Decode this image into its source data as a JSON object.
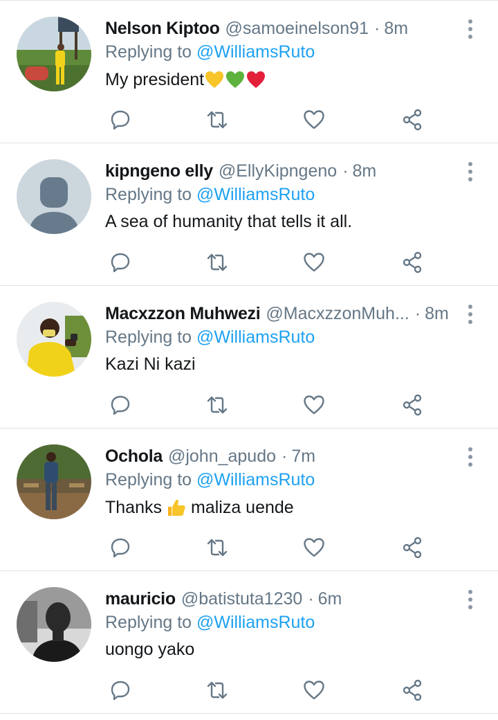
{
  "colors": {
    "link": "#1da1f2",
    "muted": "#657786",
    "text": "#14171a",
    "divider": "#dfe3e8"
  },
  "icons": {
    "reply": "reply-icon",
    "retweet": "retweet-icon",
    "like": "like-icon",
    "share": "share-icon",
    "more": "more-options-icon"
  },
  "tweets": [
    {
      "name": "Nelson Kiptoo",
      "handle": "@samoeinelson91",
      "separator": "·",
      "time": "8m",
      "replying_prefix": "Replying to",
      "replying_to": "@WilliamsRuto",
      "text": "My president",
      "emojis": [
        "yellow-heart",
        "green-heart",
        "red-heart"
      ]
    },
    {
      "name": "kipngeno elly",
      "handle": "@EllyKipngeno",
      "separator": "·",
      "time": "8m",
      "replying_prefix": "Replying to",
      "replying_to": "@WilliamsRuto",
      "text": "A sea of humanity that tells it all."
    },
    {
      "name": "Macxzzon Muhwezi",
      "handle": "@MacxzzonMuh...",
      "separator": "·",
      "time": "8m",
      "replying_prefix": "Replying to",
      "replying_to": "@WilliamsRuto",
      "text": "Kazi Ni kazi"
    },
    {
      "name": "Ochola",
      "handle": "@john_apudo",
      "separator": "·",
      "time": "7m",
      "replying_prefix": "Replying to",
      "replying_to": "@WilliamsRuto",
      "text_before": "Thanks",
      "text_after": "maliza uende",
      "emojis": [
        "thumbs-up"
      ]
    },
    {
      "name": "mauricio",
      "handle": "@batistuta1230",
      "separator": "·",
      "time": "6m",
      "replying_prefix": "Replying to",
      "replying_to": "@WilliamsRuto",
      "text": "uongo yako"
    }
  ]
}
